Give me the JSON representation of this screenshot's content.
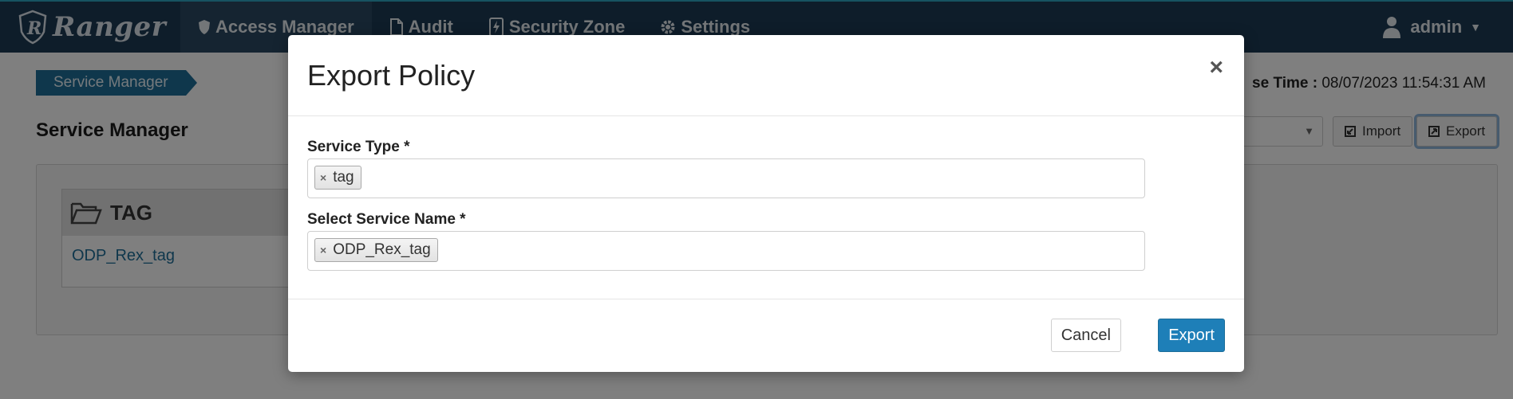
{
  "app": {
    "brand": "Ranger"
  },
  "nav": {
    "items": [
      {
        "label": "Access Manager",
        "icon": "shield-icon"
      },
      {
        "label": "Audit",
        "icon": "file-icon"
      },
      {
        "label": "Security Zone",
        "icon": "bolt-file-icon"
      },
      {
        "label": "Settings",
        "icon": "gear-icon"
      }
    ],
    "user": "admin"
  },
  "page": {
    "breadcrumb": "Service Manager",
    "title": "Service Manager",
    "update_time_label": "se Time :",
    "update_time_value": "08/07/2023 11:54:31 AM",
    "import_label": "Import",
    "export_label": "Export",
    "service_group": {
      "name": "TAG",
      "services": [
        "ODP_Rex_tag"
      ]
    }
  },
  "modal": {
    "title": "Export Policy",
    "close": "×",
    "service_type_label": "Service Type *",
    "service_type_value": "tag",
    "service_name_label": "Select Service Name *",
    "service_name_value": "ODP_Rex_tag",
    "chip_remove": "×",
    "cancel_label": "Cancel",
    "export_label": "Export"
  },
  "colors": {
    "navbar": "#1d3a55",
    "primary": "#1e7fb8",
    "link": "#1e6f99"
  }
}
